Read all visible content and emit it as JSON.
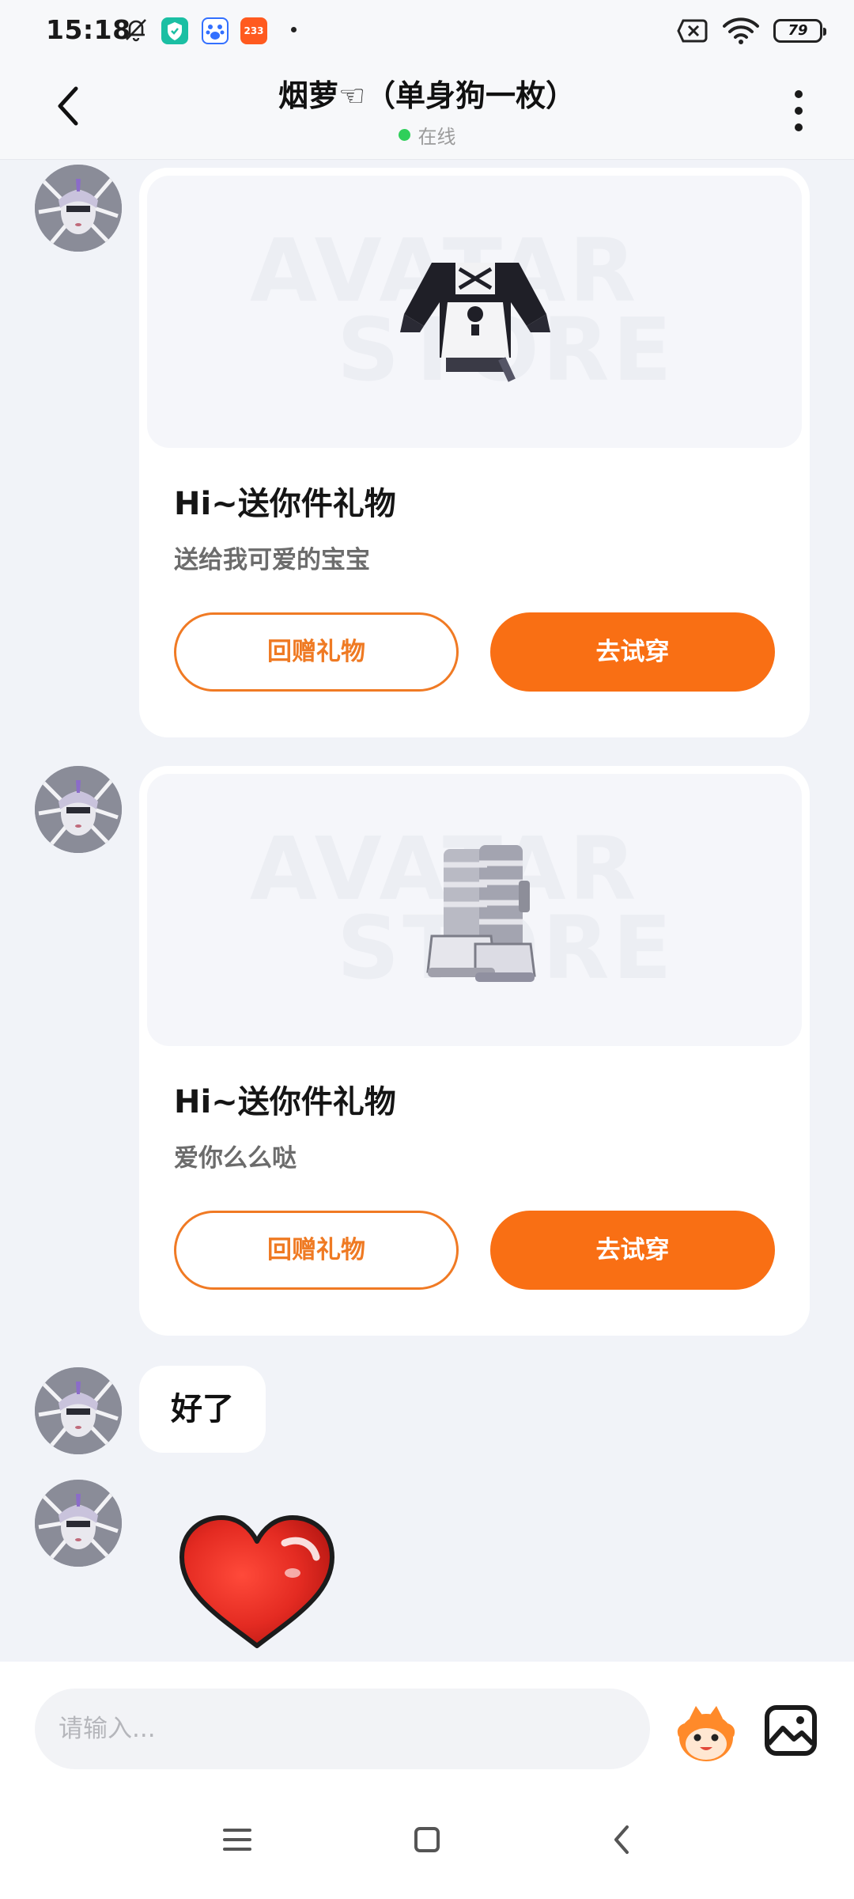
{
  "status_bar": {
    "time": "15:18",
    "app_badge_233": "233",
    "battery": "79"
  },
  "header": {
    "title": "烟萝☜（单身狗一枚）",
    "status": "在线"
  },
  "messages": [
    {
      "type": "gift",
      "item": "maid-outfit-top",
      "title": "Hi~送你件礼物",
      "message": "送给我可爱的宝宝",
      "return_gift_label": "回赠礼物",
      "try_on_label": "去试穿"
    },
    {
      "type": "gift",
      "item": "boots",
      "title": "Hi~送你件礼物",
      "message": "爱你么么哒",
      "return_gift_label": "回赠礼物",
      "try_on_label": "去试穿"
    },
    {
      "type": "text",
      "text": "好了"
    },
    {
      "type": "sticker",
      "sticker": "red-heart"
    }
  ],
  "watermark": {
    "line1": "AVATAR",
    "line2": "STORE"
  },
  "input": {
    "placeholder": "请输入..."
  },
  "colors": {
    "accent": "#f96f14",
    "accent_outline": "#ef7a23",
    "online": "#2fcf5a",
    "background": "#f1f3f8"
  },
  "icons": {
    "back": "chevron-left-icon",
    "more": "more-vertical-icon",
    "emoji": "mascot-emoji-icon",
    "image": "image-picker-icon"
  }
}
